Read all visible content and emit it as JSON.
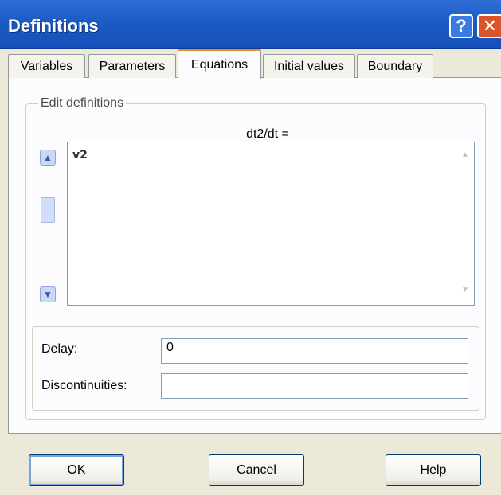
{
  "window": {
    "title": "Definitions",
    "help_glyph": "?",
    "close_glyph": "✕"
  },
  "tabs": [
    {
      "label": "Variables",
      "active": false
    },
    {
      "label": "Parameters",
      "active": false
    },
    {
      "label": "Equations",
      "active": true
    },
    {
      "label": "Initial values",
      "active": false
    },
    {
      "label": "Boundary",
      "active": false
    }
  ],
  "editor": {
    "group_label": "Edit definitions",
    "equation_label": "dt2/dt =",
    "content": "v2",
    "up_arrow": "▲",
    "down_arrow": "▼"
  },
  "fields": {
    "delay_label": "Delay:",
    "delay_value": "0",
    "discontinuities_label": "Discontinuities:",
    "discontinuities_value": ""
  },
  "buttons": {
    "ok": "OK",
    "cancel": "Cancel",
    "help": "Help"
  },
  "colors": {
    "titlebar": "#1e5cc6",
    "active_tab_accent": "#e68b2c",
    "close_button": "#d9542b"
  }
}
